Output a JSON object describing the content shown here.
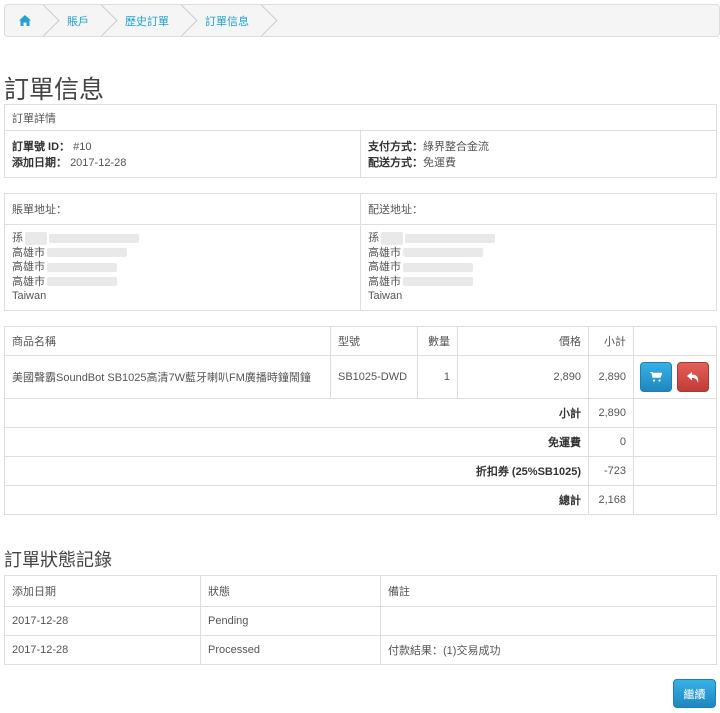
{
  "breadcrumb": {
    "home_icon": "home-icon",
    "items": [
      "賬戶",
      "歷史訂單",
      "訂單信息"
    ]
  },
  "page_title": "訂單信息",
  "order_details": {
    "header": "訂單詳情",
    "order_id_label": "訂單號 ID：",
    "order_id": "#10",
    "date_added_label": "添加日期：",
    "date_added": "2017-12-28",
    "payment_label": "支付方式：",
    "payment_method": "綠界整合金流",
    "shipping_label": "配送方式：",
    "shipping_method": "免運費"
  },
  "addresses": {
    "billing_header": "賬單地址：",
    "shipping_header": "配送地址：",
    "billing_lines": [
      "孫",
      "高雄市",
      "高雄市",
      "高雄市",
      "Taiwan"
    ],
    "shipping_lines": [
      "孫",
      "高雄市",
      "高雄市",
      "高雄市",
      "Taiwan"
    ]
  },
  "products": {
    "headers": {
      "name": "商品名稱",
      "model": "型號",
      "qty": "數量",
      "price": "價格",
      "subtotal": "小計"
    },
    "items": [
      {
        "name": "美國聲霸SoundBot SB1025高清7W藍牙喇叭FM廣播時鐘鬧鐘",
        "model": "SB1025-DWD",
        "qty": "1",
        "price": "2,890",
        "total": "2,890"
      }
    ],
    "totals": [
      {
        "label": "小計",
        "value": "2,890"
      },
      {
        "label": "免運費",
        "value": "0"
      },
      {
        "label": "折扣券 (25%SB1025)",
        "value": "-723"
      },
      {
        "label": "總計",
        "value": "2,168"
      }
    ]
  },
  "history": {
    "title": "訂單狀態記錄",
    "headers": {
      "date": "添加日期",
      "status": "狀態",
      "comment": "備註"
    },
    "rows": [
      {
        "date": "2017-12-28",
        "status": "Pending",
        "comment": ""
      },
      {
        "date": "2017-12-28",
        "status": "Processed",
        "comment": "付款結果：(1)交易成功"
      }
    ]
  },
  "continue_label": "繼續",
  "colors": {
    "accent": "#2a9fd6",
    "danger": "#d9534f",
    "link": "#23a1d1"
  }
}
